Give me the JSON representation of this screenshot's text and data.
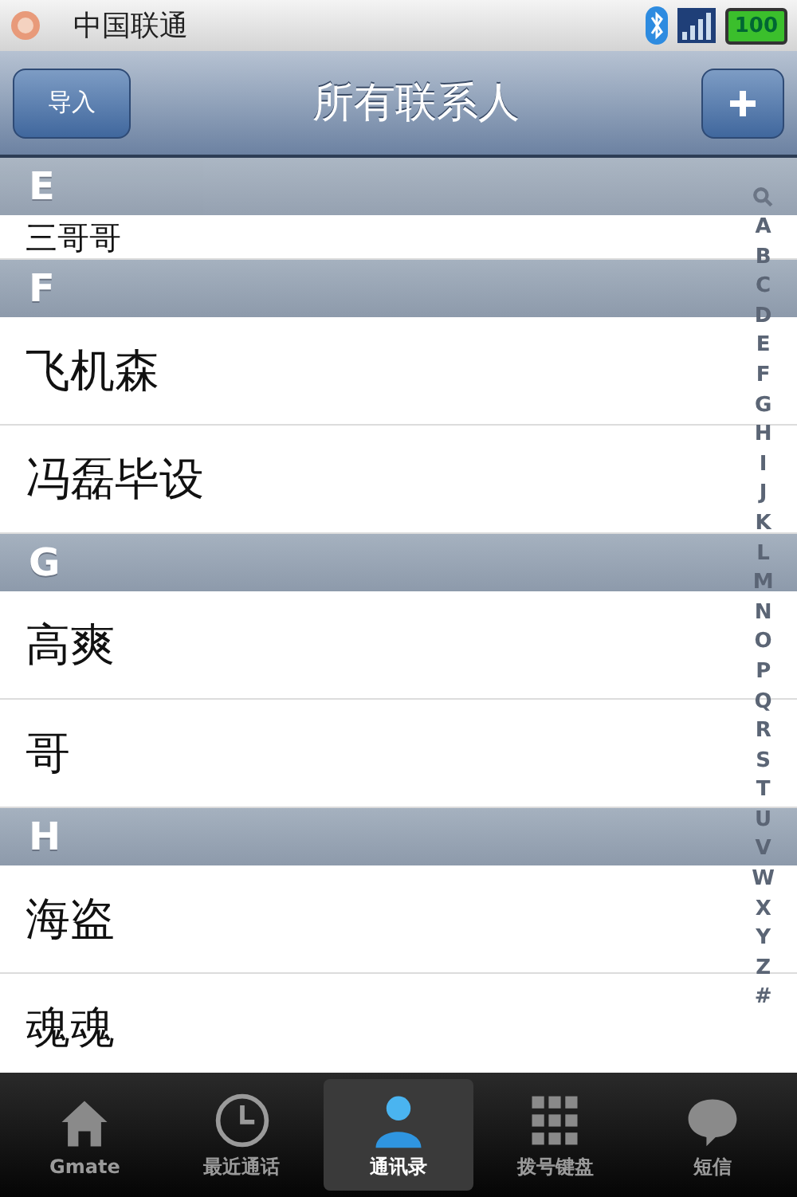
{
  "status_bar": {
    "carrier": "中国联通",
    "battery": "100"
  },
  "nav_bar": {
    "left_button": "导入",
    "title": "所有联系人"
  },
  "sticky_header": "E",
  "contacts": [
    {
      "kind": "row",
      "text": "三哥哥"
    },
    {
      "kind": "header",
      "text": "F"
    },
    {
      "kind": "row",
      "text": "飞机森"
    },
    {
      "kind": "row",
      "text": "冯磊毕设"
    },
    {
      "kind": "header",
      "text": "G"
    },
    {
      "kind": "row",
      "text": "高爽"
    },
    {
      "kind": "row",
      "text": "哥"
    },
    {
      "kind": "header",
      "text": "H"
    },
    {
      "kind": "row",
      "text": "海盗"
    },
    {
      "kind": "row",
      "text": "魂魂"
    }
  ],
  "index": [
    "A",
    "B",
    "C",
    "D",
    "E",
    "F",
    "G",
    "H",
    "I",
    "J",
    "K",
    "L",
    "M",
    "N",
    "O",
    "P",
    "Q",
    "R",
    "S",
    "T",
    "U",
    "V",
    "W",
    "X",
    "Y",
    "Z",
    "#"
  ],
  "tabs": [
    {
      "label": "Gmate",
      "selected": false
    },
    {
      "label": "最近通话",
      "selected": false
    },
    {
      "label": "通讯录",
      "selected": true
    },
    {
      "label": "拨号键盘",
      "selected": false
    },
    {
      "label": "短信",
      "selected": false
    }
  ]
}
